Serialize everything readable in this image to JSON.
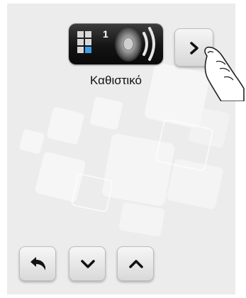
{
  "zone_tile": {
    "zone_number": "1",
    "icon": "grid-zones-icon",
    "speaker_icon": "speaker-icon"
  },
  "mode_label": "Καθιστικό",
  "buttons": {
    "next": "chevron-right-icon",
    "back": "back-arrow-icon",
    "down": "chevron-down-icon",
    "up": "chevron-up-icon"
  },
  "colors": {
    "background": "#ececec",
    "tile_dark": "#141414",
    "selected_cell": "#3a9ee8",
    "grid_cell": "#d9d9d9"
  }
}
